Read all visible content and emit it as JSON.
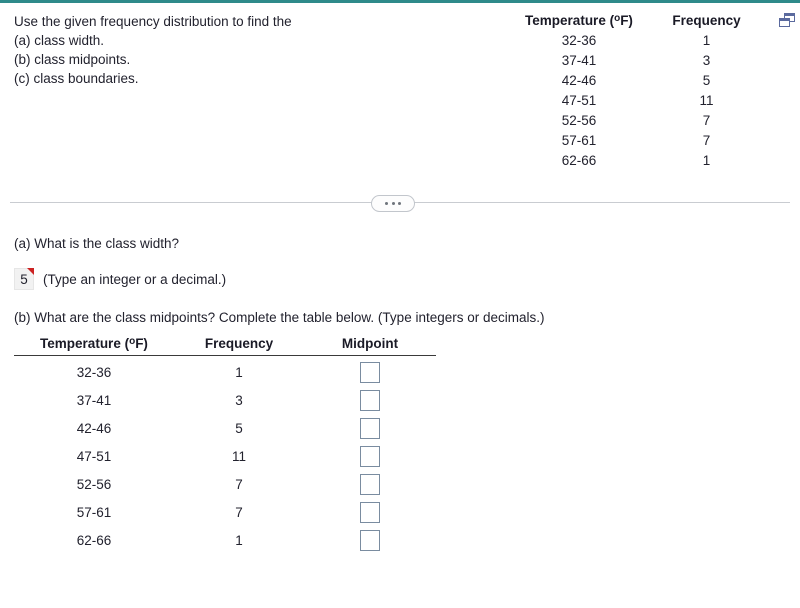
{
  "accent_color": "#2f8a8a",
  "problem": {
    "lines": [
      "Use the given frequency distribution to find the",
      "(a) class width.",
      "(b) class midpoints.",
      "(c) class boundaries."
    ]
  },
  "source_table": {
    "headers": {
      "temperature": "Temperature (",
      "temperature_unit": "o",
      "temperature_suffix": "F)",
      "frequency": "Frequency"
    },
    "rows": [
      {
        "temperature": "32-36",
        "frequency": "1"
      },
      {
        "temperature": "37-41",
        "frequency": "3"
      },
      {
        "temperature": "42-46",
        "frequency": "5"
      },
      {
        "temperature": "47-51",
        "frequency": "11"
      },
      {
        "temperature": "52-56",
        "frequency": "7"
      },
      {
        "temperature": "57-61",
        "frequency": "7"
      },
      {
        "temperature": "62-66",
        "frequency": "1"
      }
    ]
  },
  "divider": {
    "dots": [
      "",
      "",
      ""
    ]
  },
  "question_a": {
    "prompt": "(a) What is the class width?",
    "answer_value": "5",
    "answer_placeholder": "",
    "hint": "(Type an integer or a decimal.)"
  },
  "question_b": {
    "prompt": "(b) What are the class midpoints? Complete the table below. (Type integers or decimals.)",
    "table": {
      "headers": {
        "temperature": "Temperature (",
        "temperature_unit": "o",
        "temperature_suffix": "F)",
        "frequency": "Frequency",
        "midpoint": "Midpoint"
      },
      "rows": [
        {
          "temperature": "32-36",
          "frequency": "1",
          "midpoint": ""
        },
        {
          "temperature": "37-41",
          "frequency": "3",
          "midpoint": ""
        },
        {
          "temperature": "42-46",
          "frequency": "5",
          "midpoint": ""
        },
        {
          "temperature": "47-51",
          "frequency": "11",
          "midpoint": ""
        },
        {
          "temperature": "52-56",
          "frequency": "7",
          "midpoint": ""
        },
        {
          "temperature": "57-61",
          "frequency": "7",
          "midpoint": ""
        },
        {
          "temperature": "62-66",
          "frequency": "1",
          "midpoint": ""
        }
      ]
    }
  },
  "icons": {
    "popout": "popout-window-icon"
  }
}
